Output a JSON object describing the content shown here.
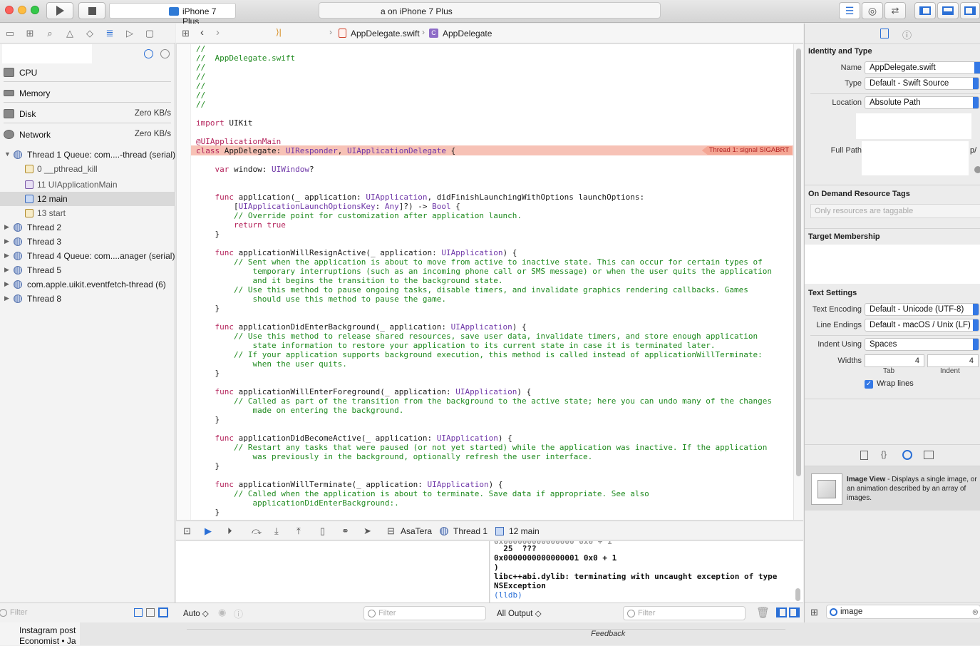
{
  "toolbar": {
    "scheme_device": "iPhone 7 Plus",
    "activity_status": "a on iPhone 7 Plus"
  },
  "debug_navigator": {
    "gauges": [
      {
        "label": "CPU",
        "value": ""
      },
      {
        "label": "Memory",
        "value": ""
      },
      {
        "label": "Disk",
        "value": "Zero KB/s"
      },
      {
        "label": "Network",
        "value": "Zero KB/s"
      }
    ],
    "thread1_label": "Thread 1 Queue: com....-thread (serial)",
    "frames": [
      "0 __pthread_kill",
      "11 UIApplicationMain",
      "12 main",
      "13 start"
    ],
    "threads": [
      "Thread 2",
      "Thread 3",
      "Thread 4 Queue: com....anager (serial)",
      "Thread 5",
      "com.apple.uikit.eventfetch-thread (6)",
      "Thread 8"
    ],
    "filter_placeholder": "Filter"
  },
  "jumpbar": {
    "file": "AppDelegate.swift",
    "symbol": "AppDelegate"
  },
  "editor": {
    "signal_badge": "Thread 1: signal SIGABRT",
    "lines": {
      "l1": "//",
      "l2": "//  AppDelegate.swift",
      "l3": "//",
      "l4": "//",
      "l5": "//",
      "l6": "//",
      "l7": "//",
      "import_kw": "import",
      "import_mod": " UIKit",
      "attr": "@UIApplicationMain",
      "class_kw": "class",
      "class_name": " AppDelegate: ",
      "class_sup1": "UIResponder",
      "class_comma": ", ",
      "class_sup2": "UIApplicationDelegate",
      "class_brace": " {",
      "var_kw": "    var",
      "var_rest": " window: ",
      "var_type": "UIWindow",
      "var_q": "?",
      "f1a_kw": "    func",
      "f1a_rest": " application(_ application: ",
      "f1a_type": "UIApplication",
      "f1a_tail": ", didFinishLaunchingWithOptions launchOptions:",
      "f1b_pre": "        [",
      "f1b_type": "UIApplicationLaunchOptionsKey",
      "f1b_mid": ": ",
      "f1b_any": "Any",
      "f1b_tail": "]?) -> ",
      "f1b_bool": "Bool",
      "f1b_brace": " {",
      "f1c": "        // Override point for customization after application launch.",
      "f1d_kw": "        return true",
      "close": "    }",
      "f2_kw": "    func",
      "f2_rest": " applicationWillResignActive(_ application: ",
      "f2_type": "UIApplication",
      "f2_tail": ") {",
      "f2c1": "        // Sent when the application is about to move from active to inactive state. This can occur for certain types of",
      "f2c2": "            temporary interruptions (such as an incoming phone call or SMS message) or when the user quits the application",
      "f2c3": "            and it begins the transition to the background state.",
      "f2c4": "        // Use this method to pause ongoing tasks, disable timers, and invalidate graphics rendering callbacks. Games",
      "f2c5": "            should use this method to pause the game.",
      "f3_kw": "    func",
      "f3_rest": " applicationDidEnterBackground(_ application: ",
      "f3_type": "UIApplication",
      "f3_tail": ") {",
      "f3c1": "        // Use this method to release shared resources, save user data, invalidate timers, and store enough application",
      "f3c2": "            state information to restore your application to its current state in case it is terminated later.",
      "f3c3": "        // If your application supports background execution, this method is called instead of applicationWillTerminate:",
      "f3c4": "            when the user quits.",
      "f4_kw": "    func",
      "f4_rest": " applicationWillEnterForeground(_ application: ",
      "f4_type": "UIApplication",
      "f4_tail": ") {",
      "f4c1": "        // Called as part of the transition from the background to the active state; here you can undo many of the changes",
      "f4c2": "            made on entering the background.",
      "f5_kw": "    func",
      "f5_rest": " applicationDidBecomeActive(_ application: ",
      "f5_type": "UIApplication",
      "f5_tail": ") {",
      "f5c1": "        // Restart any tasks that were paused (or not yet started) while the application was inactive. If the application",
      "f5c2": "            was previously in the background, optionally refresh the user interface.",
      "f6_kw": "    func",
      "f6_rest": " applicationWillTerminate(_ application: ",
      "f6_type": "UIApplication",
      "f6_tail": ") {",
      "f6c1": "        // Called when the application is about to terminate. Save data if appropriate. See also",
      "f6c2": "            applicationDidEnterBackground:."
    }
  },
  "debugbar": {
    "app": "AsaTera",
    "thread": "Thread 1",
    "frame": "12 main"
  },
  "console": {
    "lines": [
      "  25  ???",
      "0x0000000000000001 0x0 + 1",
      ")",
      "libc++abi.dylib: terminating with uncaught exception of type",
      "NSException"
    ],
    "prompt": "(lldb)"
  },
  "bottom": {
    "auto_label": "Auto ◇",
    "filter": "Filter",
    "output_label": "All Output ◇",
    "filter2": "Filter"
  },
  "inspector": {
    "identity_header": "Identity and Type",
    "name_label": "Name",
    "name_value": "AppDelegate.swift",
    "type_label": "Type",
    "type_value": "Default - Swift Source",
    "location_label": "Location",
    "location_value": "Absolute Path",
    "fullpath_label": "Full Path",
    "fullpath_tail": "p/",
    "ondemand_header": "On Demand Resource Tags",
    "tags_placeholder": "Only resources are taggable",
    "target_header": "Target Membership",
    "text_header": "Text Settings",
    "encoding_label": "Text Encoding",
    "encoding_value": "Default - Unicode (UTF-8)",
    "endings_label": "Line Endings",
    "endings_value": "Default - macOS / Unix (LF)",
    "indent_label": "Indent Using",
    "indent_value": "Spaces",
    "widths_label": "Widths",
    "tab_value": "4",
    "indent_width_value": "4",
    "tab_caption": "Tab",
    "indent_caption": "Indent",
    "wrap_label": "Wrap lines",
    "library_title": "Image View",
    "library_desc": " - Displays a single image, or an animation described by an array of images.",
    "search_value": "image"
  },
  "taskbar": {
    "line1": "Instagram post",
    "line2": "Economist • Ja",
    "feedback": "Feedback"
  }
}
